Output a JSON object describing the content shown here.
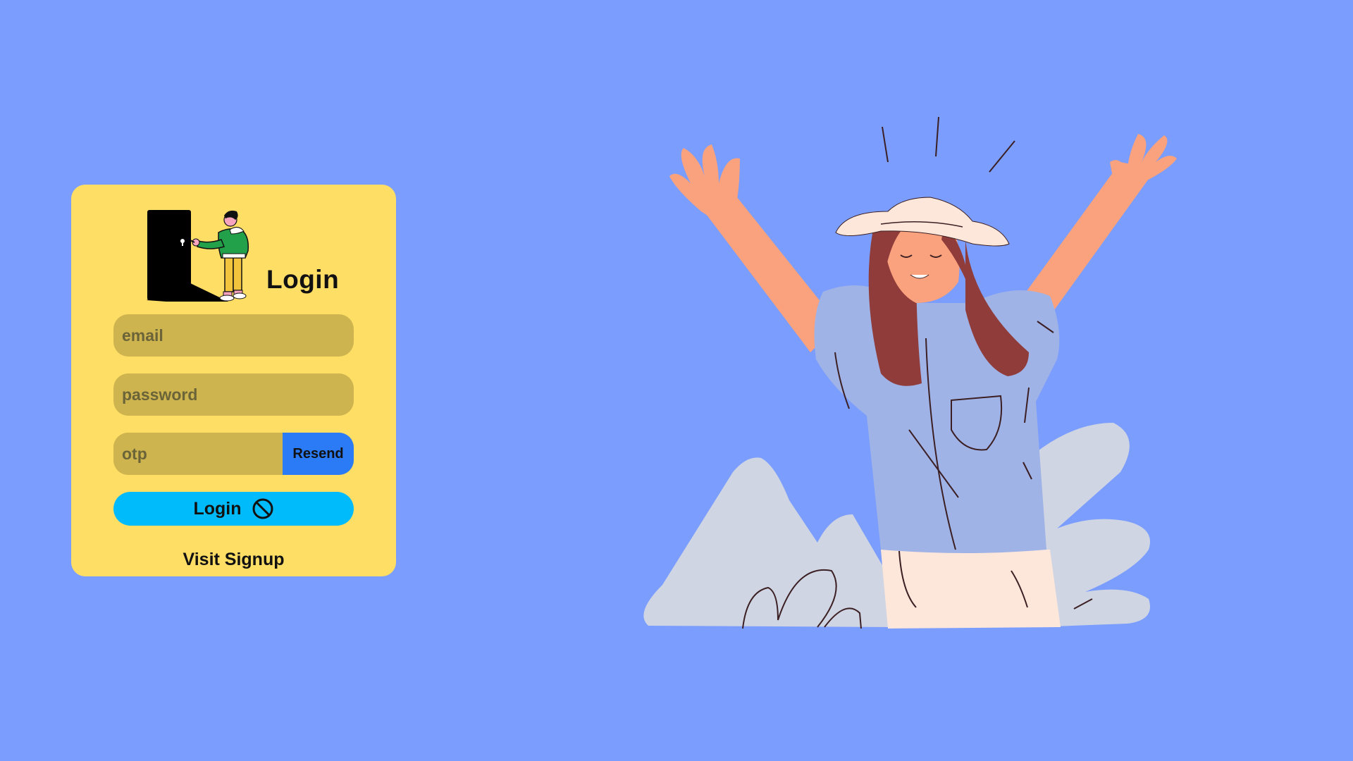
{
  "card": {
    "title": "Login",
    "email_placeholder": "email",
    "password_placeholder": "password",
    "otp_placeholder": "otp",
    "resend_label": "Resend",
    "login_label": "Login",
    "login_icon": "ban-icon",
    "signup_label": "Visit Signup"
  },
  "colors": {
    "background": "#7a9dfe",
    "card": "#ffde66",
    "field": "#ceb44f",
    "resend": "#2b7bf6",
    "login": "#00bbfb"
  },
  "illustrations": {
    "header": "person-unlocking-door-illustration",
    "hero": "celebrating-woman-illustration"
  }
}
